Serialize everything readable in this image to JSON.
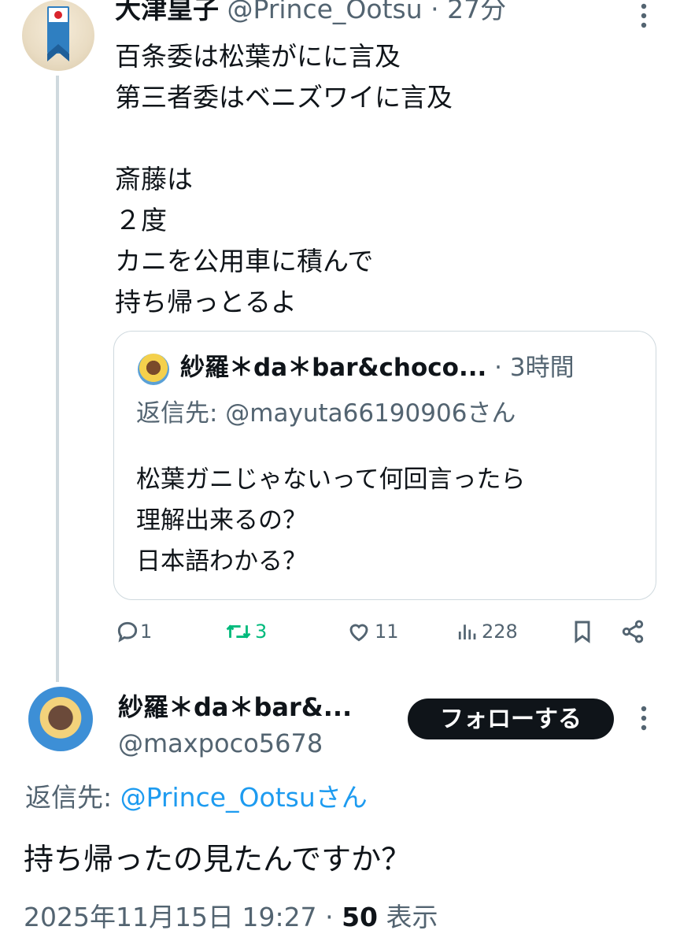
{
  "top_tweet": {
    "display_name": "大津皇子",
    "handle": "@Prince_Ootsu",
    "separator": "·",
    "time": "27分",
    "text": "百条委は松葉がにに言及\n第三者委はベニズワイに言及\n\n斎藤は\n２度\nカニを公用車に積んで\n持ち帰っとるよ",
    "quoted": {
      "display_name": "紗羅＊da＊bar&choco...",
      "separator": "·",
      "time": "3時間",
      "reply_to": "返信先: @mayuta66190906さん",
      "text": "松葉ガニじゃないって何回言ったら\n理解出来るの？\n日本語わかる？"
    },
    "actions": {
      "replies": "1",
      "retweets": "3",
      "likes": "11",
      "views": "228"
    }
  },
  "reply_tweet": {
    "display_name": "紗羅＊da＊bar&...",
    "handle": "@maxpoco5678",
    "follow_label": "フォローする",
    "reply_to_prefix": "返信先: ",
    "reply_to_handle": "@Prince_Ootsu",
    "reply_to_suffix": "さん",
    "text": "持ち帰ったの見たんですか？",
    "datetime": "2025年11月15日 19:27",
    "separator": "·",
    "views_count": "50",
    "views_label": "表示"
  },
  "colors": {
    "text": "#0f1419",
    "muted": "#536471",
    "link": "#1d9bf0",
    "retweet_active": "#00ba7c",
    "border": "#cfd9de"
  },
  "icons": [
    "more-vertical-icon",
    "reply-icon",
    "retweet-icon",
    "like-icon",
    "views-icon",
    "bookmark-icon",
    "share-icon"
  ]
}
